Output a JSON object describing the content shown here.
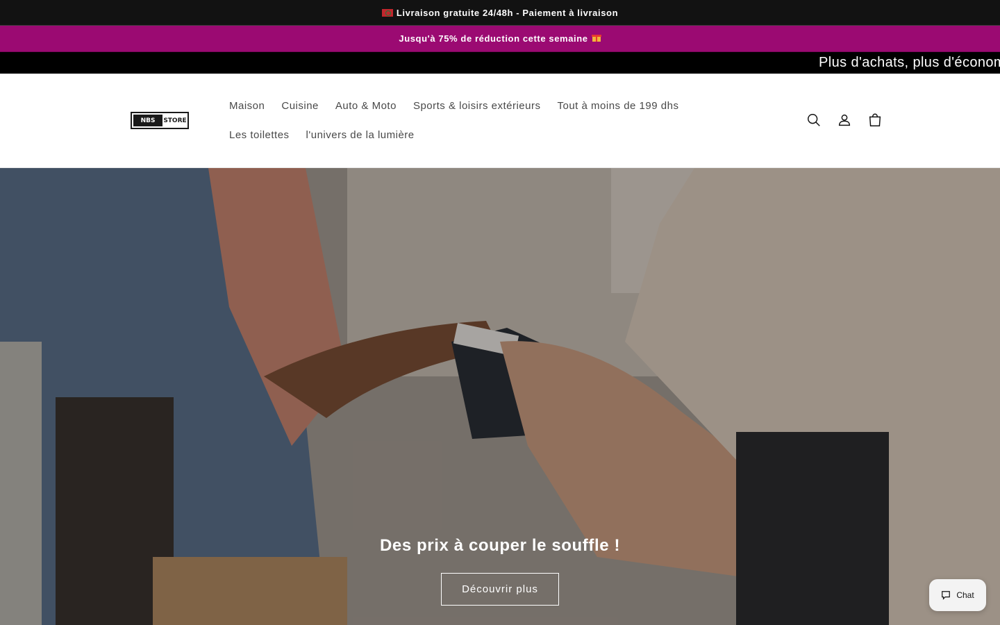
{
  "announcement_bar": {
    "text": "Livraison gratuite 24/48h - Paiement à livraison"
  },
  "promo_bar": {
    "text": "Jusqu'à 75% de réduction cette semaine"
  },
  "marquee": {
    "text": "Plus d'achats, plus d'économ"
  },
  "header": {
    "logo": {
      "left": "NBS",
      "right": "STORE"
    },
    "nav": [
      {
        "label": "Maison"
      },
      {
        "label": "Cuisine"
      },
      {
        "label": "Auto & Moto"
      },
      {
        "label": "Sports & loisirs extérieurs"
      },
      {
        "label": "Tout à moins de 199 dhs"
      },
      {
        "label": "Les toilettes"
      },
      {
        "label": "l'univers de la lumière"
      }
    ],
    "icons": [
      "search-icon",
      "account-icon",
      "cart-icon"
    ]
  },
  "hero": {
    "title": "Des prix à couper le souffle !",
    "button_label": "Découvrir plus"
  },
  "chat_widget": {
    "label": "Chat"
  },
  "colors": {
    "promo_bg": "#9b0a72",
    "dark_bar": "#121212"
  }
}
